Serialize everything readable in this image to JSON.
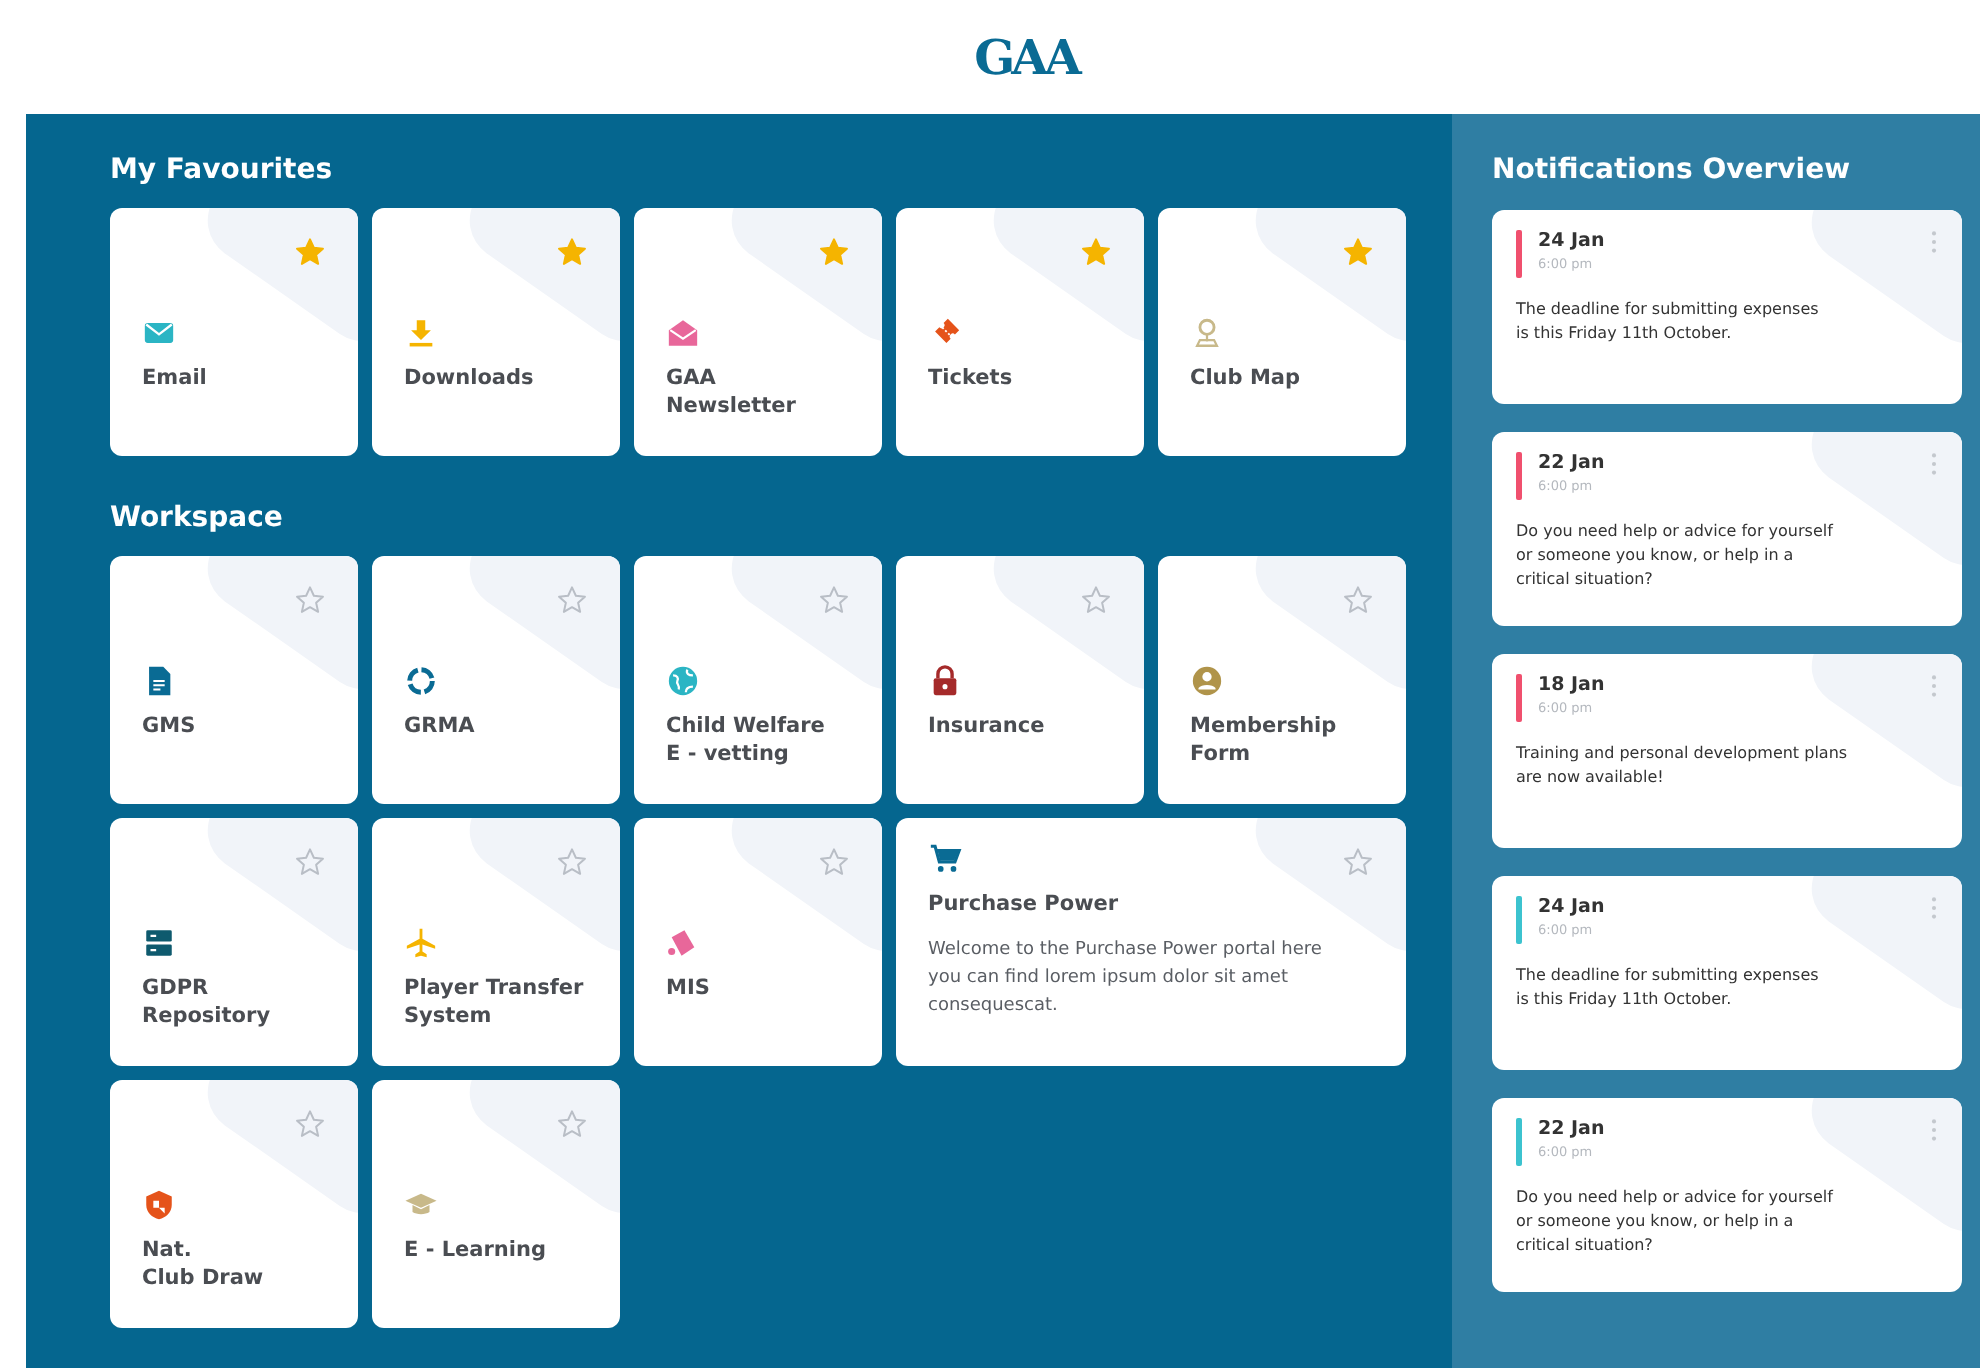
{
  "logo": "GAA",
  "favourites": {
    "title": "My Favourites",
    "tiles": [
      {
        "label": "Email",
        "color": "#2bb5c4",
        "starred": true
      },
      {
        "label": "Downloads",
        "color": "#f5b400",
        "starred": true
      },
      {
        "label": "GAA\nNewsletter",
        "color": "#e8679a",
        "starred": true
      },
      {
        "label": "Tickets",
        "color": "#e5531a",
        "starred": true
      },
      {
        "label": "Club Map",
        "color": "#c8b98a",
        "starred": true
      }
    ]
  },
  "workspace": {
    "title": "Workspace",
    "tiles": [
      {
        "label": "GMS",
        "color": "#0a6b94",
        "starred": false
      },
      {
        "label": "GRMA",
        "color": "#0a6b94",
        "starred": false
      },
      {
        "label": "Child Welfare\nE - vetting",
        "color": "#2bb5c4",
        "starred": false
      },
      {
        "label": "Insurance",
        "color": "#a52a2a",
        "starred": false
      },
      {
        "label": "Membership\nForm",
        "color": "#b0944a",
        "starred": false
      },
      {
        "label": "GDPR\nRepository",
        "color": "#0e5a6e",
        "starred": false
      },
      {
        "label": "Player Transfer\nSystem",
        "color": "#f5b400",
        "starred": false
      },
      {
        "label": "MIS",
        "color": "#e8679a",
        "starred": false
      },
      {
        "label": "Purchase Power",
        "color": "#0a6b94",
        "starred": false,
        "description": "Welcome to the Purchase Power portal here you can find lorem ipsum dolor sit amet consequescat."
      },
      {
        "label": "Nat.\nClub Draw",
        "color": "#e5531a",
        "starred": false
      },
      {
        "label": "E - Learning",
        "color": "#c8b98a",
        "starred": false
      }
    ]
  },
  "notifications": {
    "title": "Notifications Overview",
    "items": [
      {
        "date": "24 Jan",
        "time": "6:00 pm",
        "text": "The deadline for submitting expenses\nis this Friday 11th October.",
        "color": "#f0506e"
      },
      {
        "date": "22 Jan",
        "time": "6:00 pm",
        "text": "Do you need help or advice for yourself\nor someone you know, or help in a\ncritical situation?",
        "color": "#f0506e"
      },
      {
        "date": "18 Jan",
        "time": "6:00 pm",
        "text": "Training and personal development plans\nare now available!",
        "color": "#f0506e"
      },
      {
        "date": "24 Jan",
        "time": "6:00 pm",
        "text": "The deadline for submitting expenses\nis this Friday 11th October.",
        "color": "#3cc3cf"
      },
      {
        "date": "22 Jan",
        "time": "6:00 pm",
        "text": "Do you need help or advice for yourself\nor someone you know, or help in a\ncritical situation?",
        "color": "#3cc3cf"
      }
    ]
  }
}
